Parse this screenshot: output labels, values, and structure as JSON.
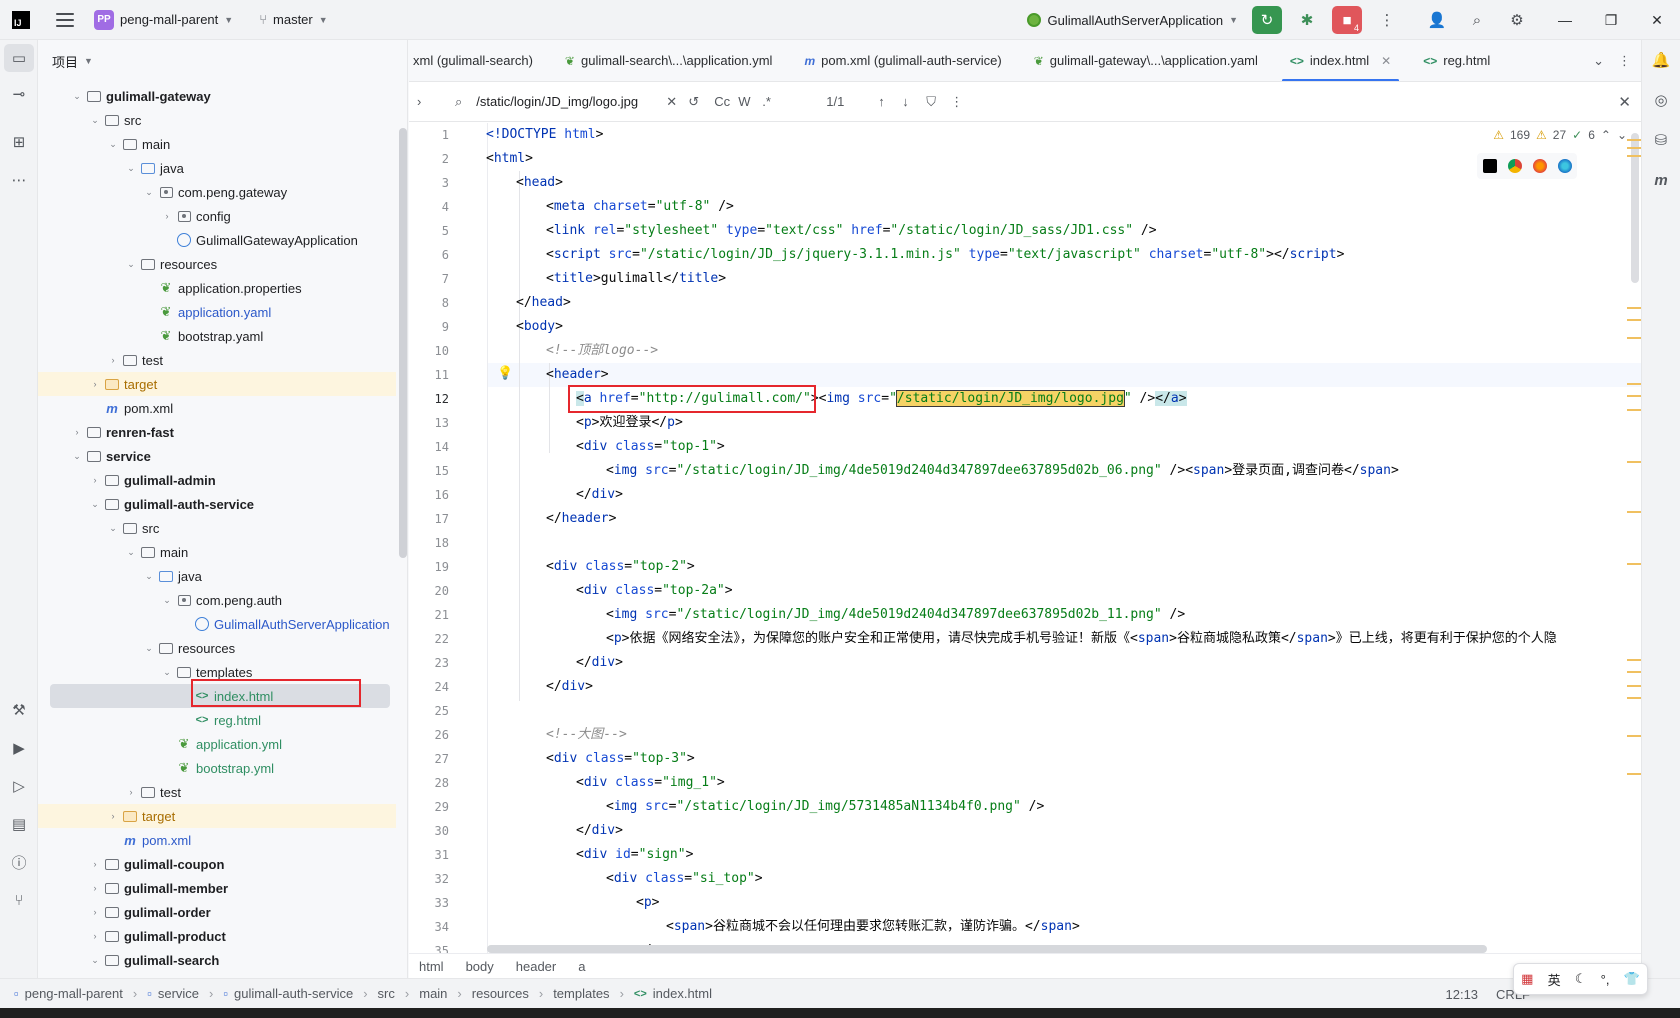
{
  "titlebar": {
    "project_badge": "PP",
    "project_name": "peng-mall-parent",
    "branch": "master",
    "run_config": "GulimallAuthServerApplication",
    "notif_count": "4"
  },
  "project_panel": {
    "title": "项目",
    "rows": [
      {
        "label": "gulimall-gateway",
        "bold": true
      },
      {
        "label": "src"
      },
      {
        "label": "main"
      },
      {
        "label": "java"
      },
      {
        "label": "com.peng.gateway"
      },
      {
        "label": "config"
      },
      {
        "label": "GulimallGatewayApplication"
      },
      {
        "label": "resources"
      },
      {
        "label": "application.properties"
      },
      {
        "label": "application.yaml"
      },
      {
        "label": "bootstrap.yaml"
      },
      {
        "label": "test"
      },
      {
        "label": "target"
      },
      {
        "label": "pom.xml"
      },
      {
        "label": "renren-fast",
        "bold": true
      },
      {
        "label": "service",
        "bold": true
      },
      {
        "label": "gulimall-admin",
        "bold": true
      },
      {
        "label": "gulimall-auth-service",
        "bold": true
      },
      {
        "label": "src"
      },
      {
        "label": "main"
      },
      {
        "label": "java"
      },
      {
        "label": "com.peng.auth"
      },
      {
        "label": "GulimallAuthServerApplication"
      },
      {
        "label": "resources"
      },
      {
        "label": "templates"
      },
      {
        "label": "index.html"
      },
      {
        "label": "reg.html"
      },
      {
        "label": "application.yml"
      },
      {
        "label": "bootstrap.yml"
      },
      {
        "label": "test"
      },
      {
        "label": "target"
      },
      {
        "label": "pom.xml"
      },
      {
        "label": "gulimall-coupon",
        "bold": true
      },
      {
        "label": "gulimall-member",
        "bold": true
      },
      {
        "label": "gulimall-order",
        "bold": true
      },
      {
        "label": "gulimall-product",
        "bold": true
      },
      {
        "label": "gulimall-search",
        "bold": true
      }
    ]
  },
  "tabs": [
    {
      "label": "xml (gulimall-search)"
    },
    {
      "label": "gulimall-search\\...\\application.yml"
    },
    {
      "label": "pom.xml (gulimall-auth-service)"
    },
    {
      "label": "gulimall-gateway\\...\\application.yaml"
    },
    {
      "label": "index.html",
      "active": true
    },
    {
      "label": "reg.html"
    }
  ],
  "find": {
    "query": "/static/login/JD_img/logo.jpg",
    "opt_case": "Cc",
    "opt_word": "W",
    "opt_regex": ".*",
    "count": "1/1"
  },
  "inspections": {
    "warnings": "169",
    "weak_warnings": "27",
    "ok": "6"
  },
  "code": {
    "line_numbers": [
      "1",
      "2",
      "3",
      "4",
      "5",
      "6",
      "7",
      "8",
      "9",
      "10",
      "11",
      "12",
      "13",
      "14",
      "15",
      "16",
      "17",
      "18",
      "19",
      "20",
      "21",
      "22",
      "23",
      "24",
      "25",
      "26",
      "27",
      "28",
      "29",
      "30",
      "31",
      "32",
      "33",
      "34",
      "35"
    ]
  },
  "editor_breadcrumb": [
    "html",
    "body",
    "header",
    "a"
  ],
  "statusbar": {
    "crumbs": [
      "peng-mall-parent",
      "service",
      "gulimall-auth-service",
      "src",
      "main",
      "resources",
      "templates",
      "index.html"
    ],
    "position": "12:13",
    "line_sep": "CRLF"
  },
  "ime": {
    "lang": "英"
  }
}
